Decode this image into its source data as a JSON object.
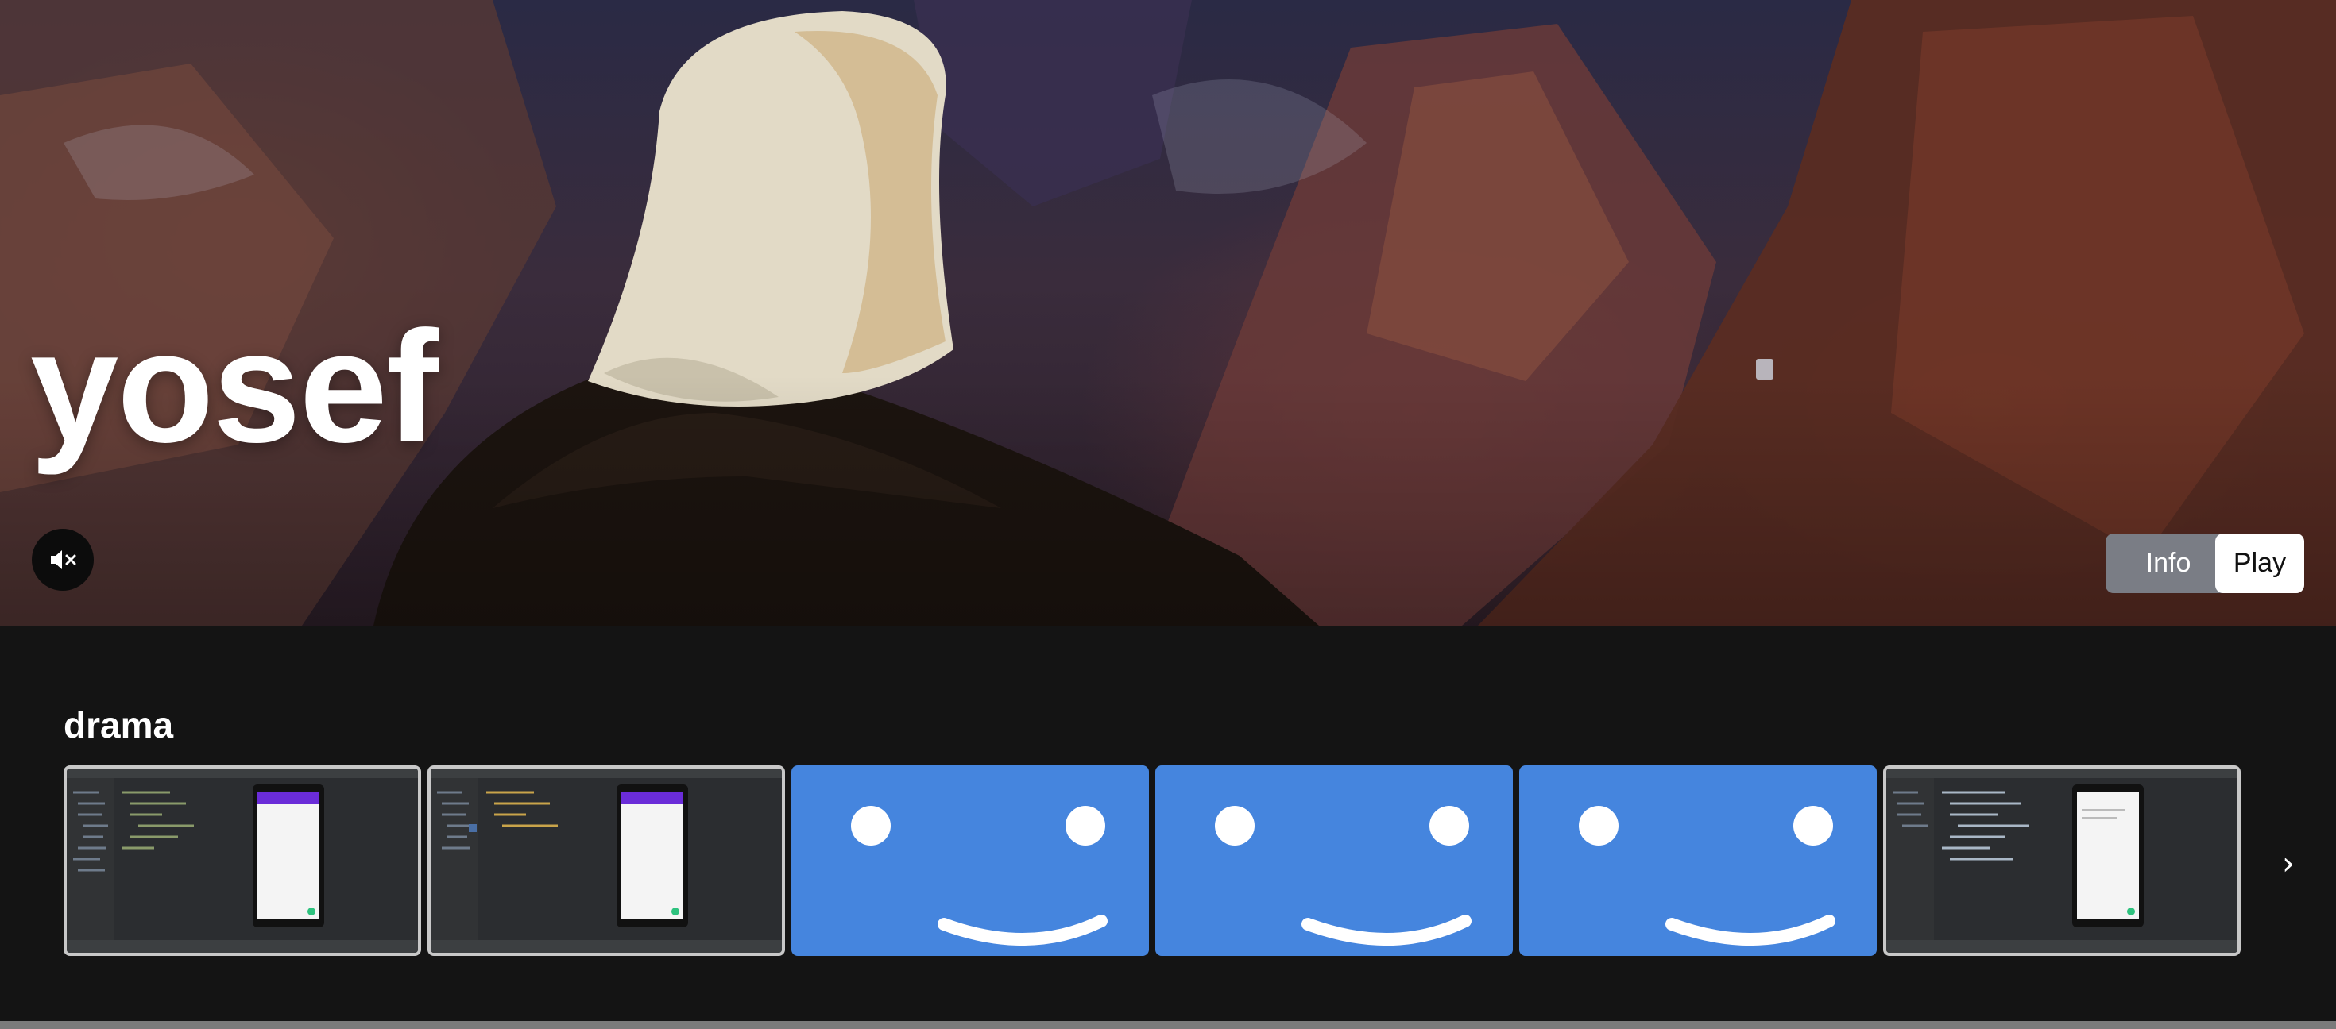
{
  "hero": {
    "title": "yosef",
    "mute_icon": "speaker-muted-icon",
    "info_label": "Info",
    "play_label": "Play"
  },
  "row": {
    "title": "drama",
    "tiles": [
      {
        "kind": "screenshot",
        "icon": "ide-screenshot-thumbnail"
      },
      {
        "kind": "screenshot",
        "icon": "ide-screenshot-thumbnail"
      },
      {
        "kind": "smiley",
        "icon": "smiley-placeholder-thumbnail"
      },
      {
        "kind": "smiley",
        "icon": "smiley-placeholder-thumbnail"
      },
      {
        "kind": "smiley",
        "icon": "smiley-placeholder-thumbnail"
      },
      {
        "kind": "screenshot",
        "icon": "ide-screenshot-thumbnail"
      }
    ],
    "next_icon": "›"
  },
  "colors": {
    "background": "#141414",
    "tile_blue": "#4585de",
    "info_button": "#7a7d85",
    "play_button": "#ffffff"
  }
}
